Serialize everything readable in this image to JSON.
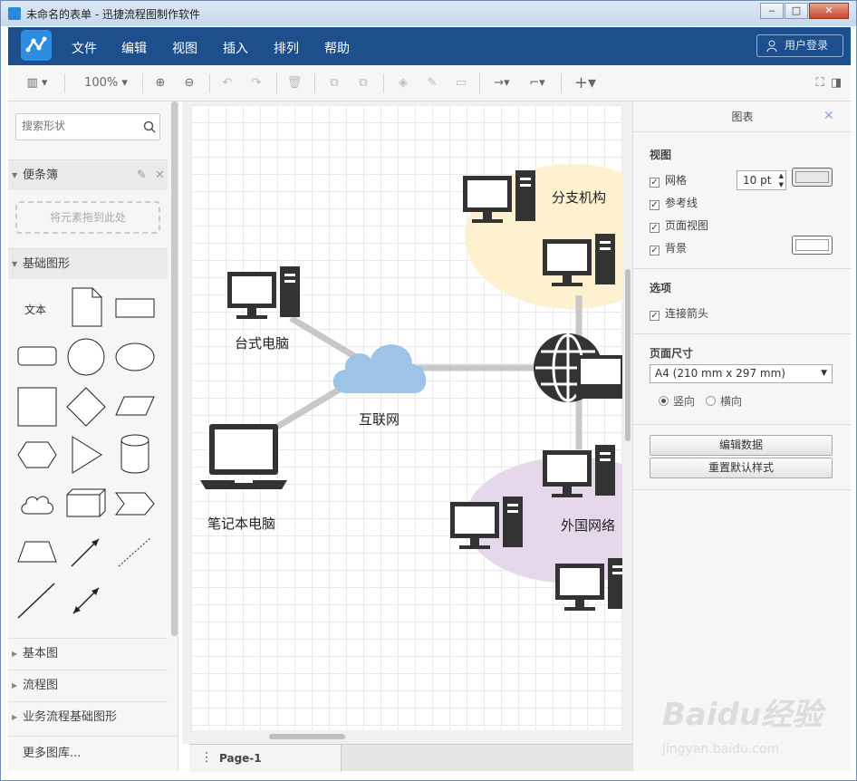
{
  "window": {
    "title": "未命名的表单 - 迅捷流程图制作软件"
  },
  "menu": {
    "items": [
      "文件",
      "编辑",
      "视图",
      "插入",
      "排列",
      "帮助"
    ],
    "login": "用户登录"
  },
  "toolbar": {
    "zoom": "100%"
  },
  "left": {
    "search_placeholder": "搜索形状",
    "sticky_title": "便条簿",
    "dropzone": "将元素拖到此处",
    "basic_shapes_title": "基础图形",
    "shape_text_label": "文本",
    "collapsed": [
      "基本图",
      "流程图",
      "业务流程基础图形"
    ],
    "more": "更多图库..."
  },
  "diagram": {
    "labels": {
      "desktop": "台式电脑",
      "laptop": "笔记本电脑",
      "internet": "互联网",
      "branch": "分支机构",
      "foreign": "外国网络"
    },
    "colors": {
      "branch": "#fdf1d0",
      "foreign": "#e4d8ea",
      "cloud": "#9dc3e6",
      "line": "#c8c8c8",
      "device": "#333333"
    }
  },
  "pagebar": {
    "page_name": "Page-1"
  },
  "right": {
    "title": "图表",
    "view_title": "视图",
    "grid": "网格",
    "grid_size": "10 pt",
    "guides": "参考线",
    "page_view": "页面视图",
    "background": "背景",
    "options_title": "选项",
    "connect_arrows": "连接箭头",
    "page_size_title": "页面尺寸",
    "page_size": "A4 (210 mm x 297 mm)",
    "portrait": "竖向",
    "landscape": "横向",
    "edit_data": "编辑数据",
    "reset_style": "重置默认样式"
  },
  "watermark": {
    "brand": "Baidu经验",
    "url": "jingyan.baidu.com"
  }
}
